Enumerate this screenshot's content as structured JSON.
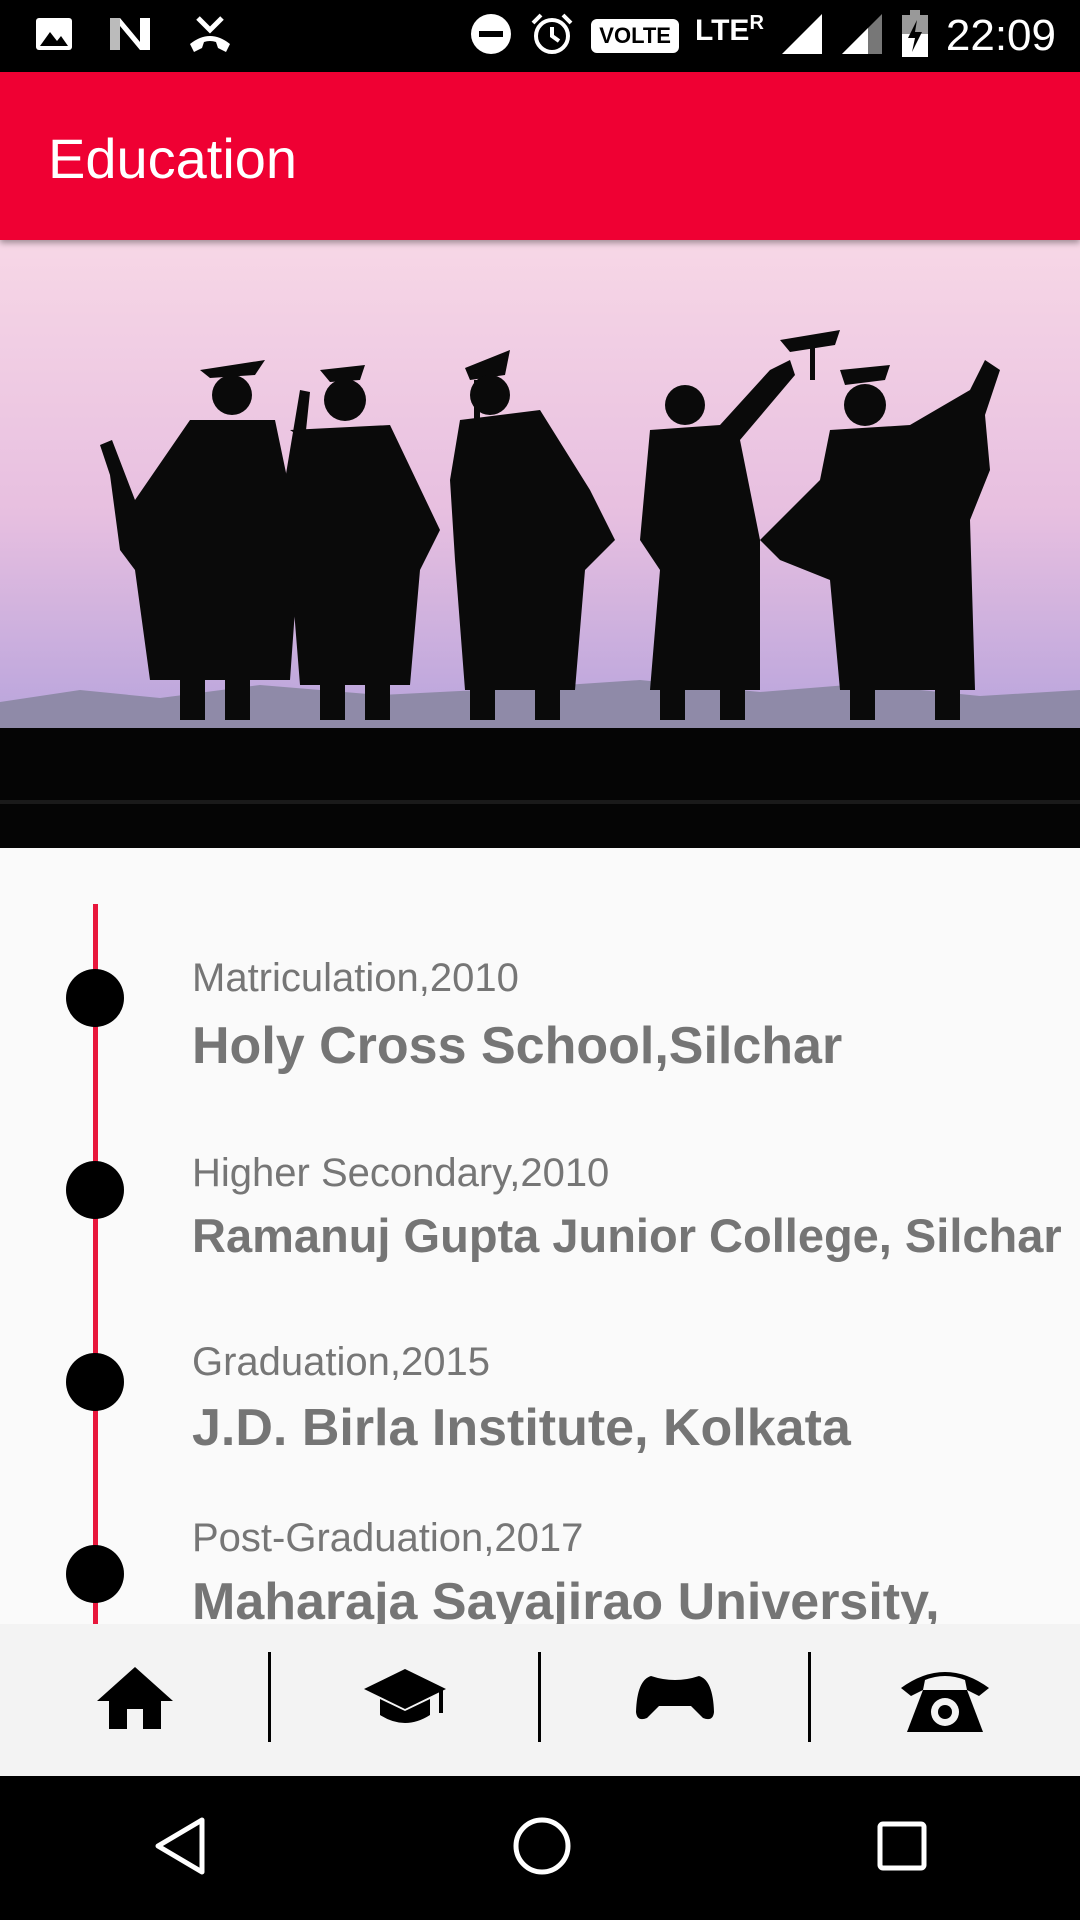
{
  "status_bar": {
    "time": "22:09",
    "volte": "VOLTE",
    "lte": "LTE",
    "roaming": "R",
    "left_icons": [
      "image-icon",
      "n-icon",
      "missed-call-icon"
    ],
    "right_icons": [
      "do-not-disturb-icon",
      "alarm-icon",
      "volte-badge",
      "signal-icon",
      "signal-icon",
      "battery-charging-icon"
    ]
  },
  "app_bar": {
    "title": "Education"
  },
  "timeline": [
    {
      "subtitle": "Matriculation,2010",
      "title": "Holy Cross School,Silchar"
    },
    {
      "subtitle": "Higher Secondary,2010",
      "title": "Ramanuj Gupta Junior College, Silchar"
    },
    {
      "subtitle": "Graduation,2015",
      "title": "J.D. Birla Institute, Kolkata"
    },
    {
      "subtitle": "Post-Graduation,2017",
      "title": "Maharaja Sayajirao University,"
    }
  ],
  "bottom_nav": [
    "home-icon",
    "graduation-cap-icon",
    "gamepad-icon",
    "telephone-icon"
  ],
  "system_nav": [
    "back-icon",
    "home-circle-icon",
    "recents-icon"
  ],
  "colors": {
    "accent": "#ef0033",
    "timeline_line": "#e8173c"
  }
}
